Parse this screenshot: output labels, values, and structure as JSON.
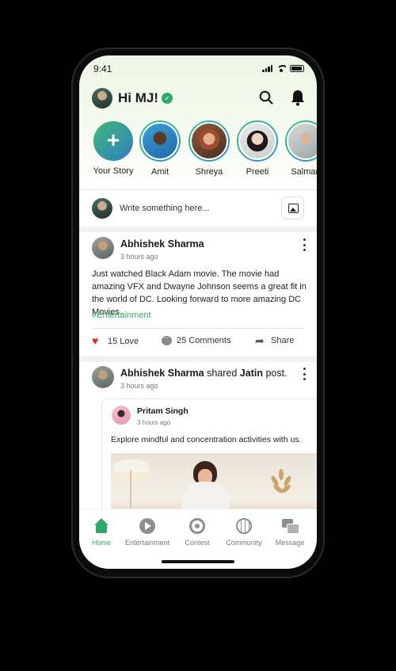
{
  "status_bar": {
    "time": "9:41"
  },
  "header": {
    "greeting": "Hi MJ!"
  },
  "stories": [
    {
      "name": "Your Story"
    },
    {
      "name": "Amit"
    },
    {
      "name": "Shreya"
    },
    {
      "name": "Preeti"
    },
    {
      "name": "Salman"
    }
  ],
  "composer": {
    "placeholder": "Write something here..."
  },
  "posts": [
    {
      "author": "Abhishek Sharma",
      "time": "3 hours ago",
      "text": "Just watched Black Adam movie. The movie had amazing VFX and Dwayne Johnson seems a great fit in the world of DC. Looking forward to more amazing DC Movies.",
      "hashtag": "#Entertainment",
      "love_label": "15 Love",
      "comments_label": "25 Comments",
      "share_label": "Share"
    },
    {
      "author": "Abhishek Sharma",
      "action_text": "shared",
      "shared_from": "Jatin",
      "action_suffix": "post.",
      "time": "3 hours ago",
      "shared_post": {
        "author": "Pritam Singh",
        "time": "3 hours ago",
        "text": "Explore mindful and concentration activities with us."
      }
    }
  ],
  "bottom_nav": [
    {
      "label": "Home",
      "icon": "home-icon",
      "active": true
    },
    {
      "label": "Entertainment",
      "icon": "play-icon"
    },
    {
      "label": "Contest",
      "icon": "contest-icon"
    },
    {
      "label": "Community",
      "icon": "globe-icon"
    },
    {
      "label": "Message",
      "icon": "message-icon"
    }
  ],
  "colors": {
    "accent": "#2fa86b",
    "love": "#e0262f",
    "story_ring_start": "#3ac37d",
    "story_ring_end": "#2f8fcf"
  }
}
